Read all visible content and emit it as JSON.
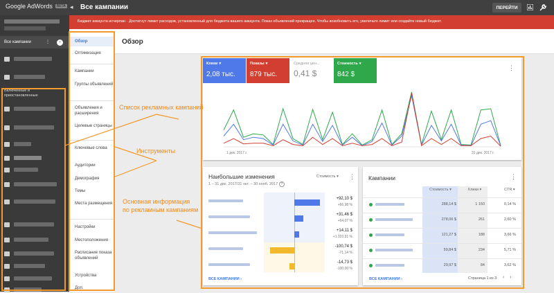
{
  "app": {
    "logo_text": "Google AdWords",
    "logo_badge": "BETA",
    "page_title": "Все кампании",
    "goto_label": "ПЕРЕЙТИ",
    "collapse_glyph": "◂",
    "chart_icon_glyph": "▮",
    "wrench_icon_glyph": "✎",
    "help_icon_glyph": "?"
  },
  "alert": {
    "text": "Бюджет аккаунта исчерпан · Достигнут лимит расходов, установленный для бюджета вашего аккаунта. Показ объявлений прекращен. Чтобы возобновить его, увеличьте лимит или создайте новый бюджет."
  },
  "leftnav": {
    "all_campaigns": "Все кампании",
    "more_glyph": "⋮",
    "arrow_glyph": "›",
    "section_label": "Включенные и приостановленные"
  },
  "menu": {
    "items": [
      "Обзор",
      "Оптимизация",
      "Кампании",
      "Группы объявлений",
      "Объявления и расширения",
      "Целевые страницы",
      "Ключевые слова",
      "Аудитории",
      "Демография",
      "Темы",
      "Места размещения",
      "Настройки",
      "Местоположения",
      "Расписание показа объявлений",
      "Устройства",
      "Доп."
    ]
  },
  "overview": {
    "title": "Обзор"
  },
  "metrics": [
    {
      "label": "Клики",
      "value": "2,08 тыс.",
      "color": "#4f78e8"
    },
    {
      "label": "Показы",
      "value": "879 тыс.",
      "color": "#d23f31"
    },
    {
      "label": "Средняя цен...",
      "value": "0,41 $",
      "color": "#ffffff"
    },
    {
      "label": "Стоимость",
      "value": "842 $",
      "color": "#2ea84b"
    }
  ],
  "chart_data": {
    "type": "line",
    "x_labels": [
      "1 дек. 2017 г.",
      "31 дек. 2017 г."
    ],
    "series": [
      {
        "color": "#2ea84b",
        "values": [
          28,
          62,
          16,
          22,
          20,
          4,
          64,
          14,
          4,
          63,
          12,
          58,
          4,
          22,
          3,
          12,
          62,
          4,
          22,
          92,
          4,
          60,
          12,
          62,
          4,
          3,
          62,
          64,
          2
        ]
      },
      {
        "color": "#4f78e8",
        "values": [
          18,
          38,
          12,
          16,
          14,
          3,
          38,
          10,
          3,
          38,
          9,
          36,
          3,
          16,
          2,
          9,
          40,
          3,
          18,
          86,
          3,
          36,
          10,
          38,
          3,
          2,
          38,
          44,
          2
        ]
      },
      {
        "color": "#d23f31",
        "values": [
          6,
          14,
          5,
          6,
          6,
          2,
          12,
          4,
          2,
          16,
          4,
          14,
          2,
          6,
          2,
          4,
          14,
          2,
          8,
          90,
          2,
          14,
          4,
          14,
          2,
          2,
          14,
          18,
          1
        ]
      }
    ]
  },
  "changes": {
    "title": "Наибольшие изменения",
    "period": "1 – 31 дек. 2017/31 окт. – 30 нояб. 2017",
    "sort_label": "Стоимость",
    "rows": [
      {
        "value": "+92,10 $",
        "pct": "+66,98 %",
        "bar": 0.62
      },
      {
        "value": "+31,46 $",
        "pct": "+64,07 %",
        "bar": 0.22
      },
      {
        "value": "+14,11 $",
        "pct": "+1 323,91 %",
        "bar": 0.12
      },
      {
        "value": "-100,74 $",
        "pct": "-71,14 %",
        "bar": -0.58
      },
      {
        "value": "-14,73 $",
        "pct": "-100,00 %",
        "bar": -0.12
      }
    ],
    "footer_link": "ВСЕ КАМПАНИИ"
  },
  "campaigns": {
    "title": "Кампании",
    "columns": [
      "Стоимость",
      "Клики",
      "CTR"
    ],
    "rows": [
      {
        "cost": "288,14 $",
        "clicks": "1 150",
        "ctr": "0,14 %"
      },
      {
        "cost": "278,06 $",
        "clicks": "261",
        "ctr": "2,60 %"
      },
      {
        "cost": "121,27 $",
        "clicks": "188",
        "ctr": "3,66 %"
      },
      {
        "cost": "59,84 $",
        "clicks": "234",
        "ctr": "5,71 %"
      },
      {
        "cost": "29,97 $",
        "clicks": "84",
        "ctr": "3,62 %"
      }
    ],
    "footer_link": "ВСЕ КАМПАНИИ",
    "pagination": "Страница 1 из 3"
  },
  "annotations": {
    "list": "Список рекламных кампаний",
    "tools": "Инструменты",
    "main_line1": "Основная информация",
    "main_line2": "по рекламным кампаниям"
  },
  "colors": {
    "accent_orange": "#f39a2b",
    "blue": "#4f78e8",
    "red": "#d23f31",
    "green": "#2ea84b"
  }
}
